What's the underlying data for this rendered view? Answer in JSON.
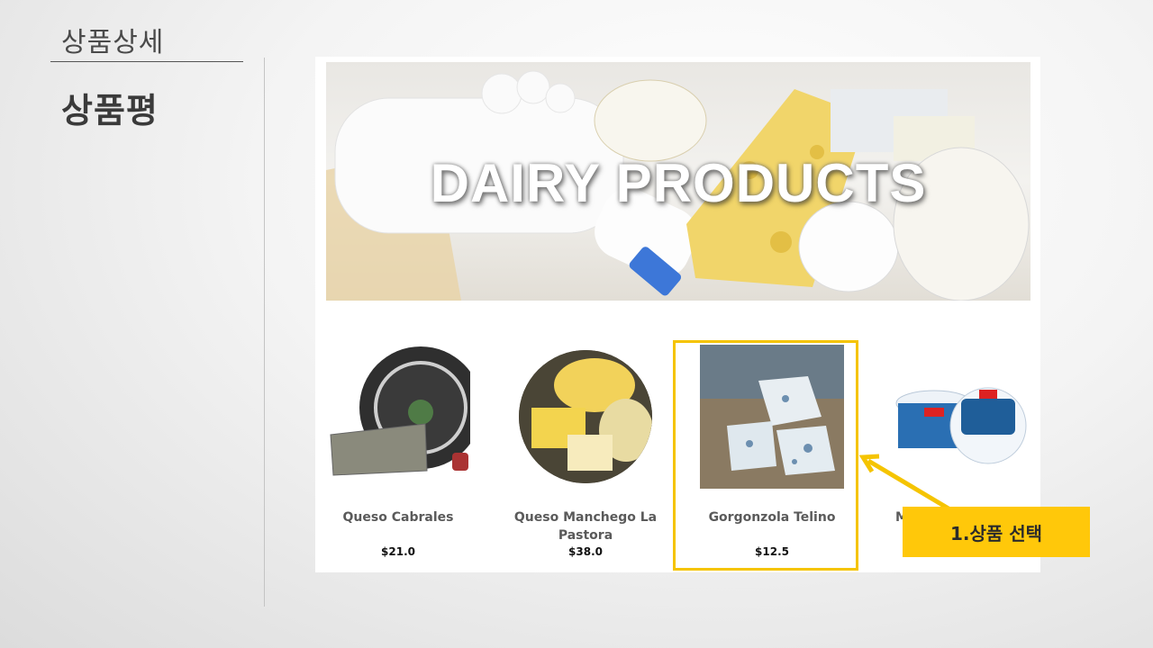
{
  "slide": {
    "section_title": "상품상세",
    "page_title": "상품평"
  },
  "banner": {
    "title": "DAIRY PRODUCTS"
  },
  "products": [
    {
      "name": "Queso Cabrales",
      "price": "$21.0",
      "image": "cabrales-cheese-image"
    },
    {
      "name": "Queso Manchego La Pastora",
      "price": "$38.0",
      "image": "manchego-cheese-image"
    },
    {
      "name": "Gorgonzola Telino",
      "price": "$12.5",
      "image": "gorgonzola-cheese-image"
    },
    {
      "name": "M",
      "price": "",
      "image": "mascarpone-tub-image"
    }
  ],
  "annotation": {
    "label": "1.상품 선택",
    "color": "#ffc80a",
    "highlight_color": "#f5c400"
  }
}
